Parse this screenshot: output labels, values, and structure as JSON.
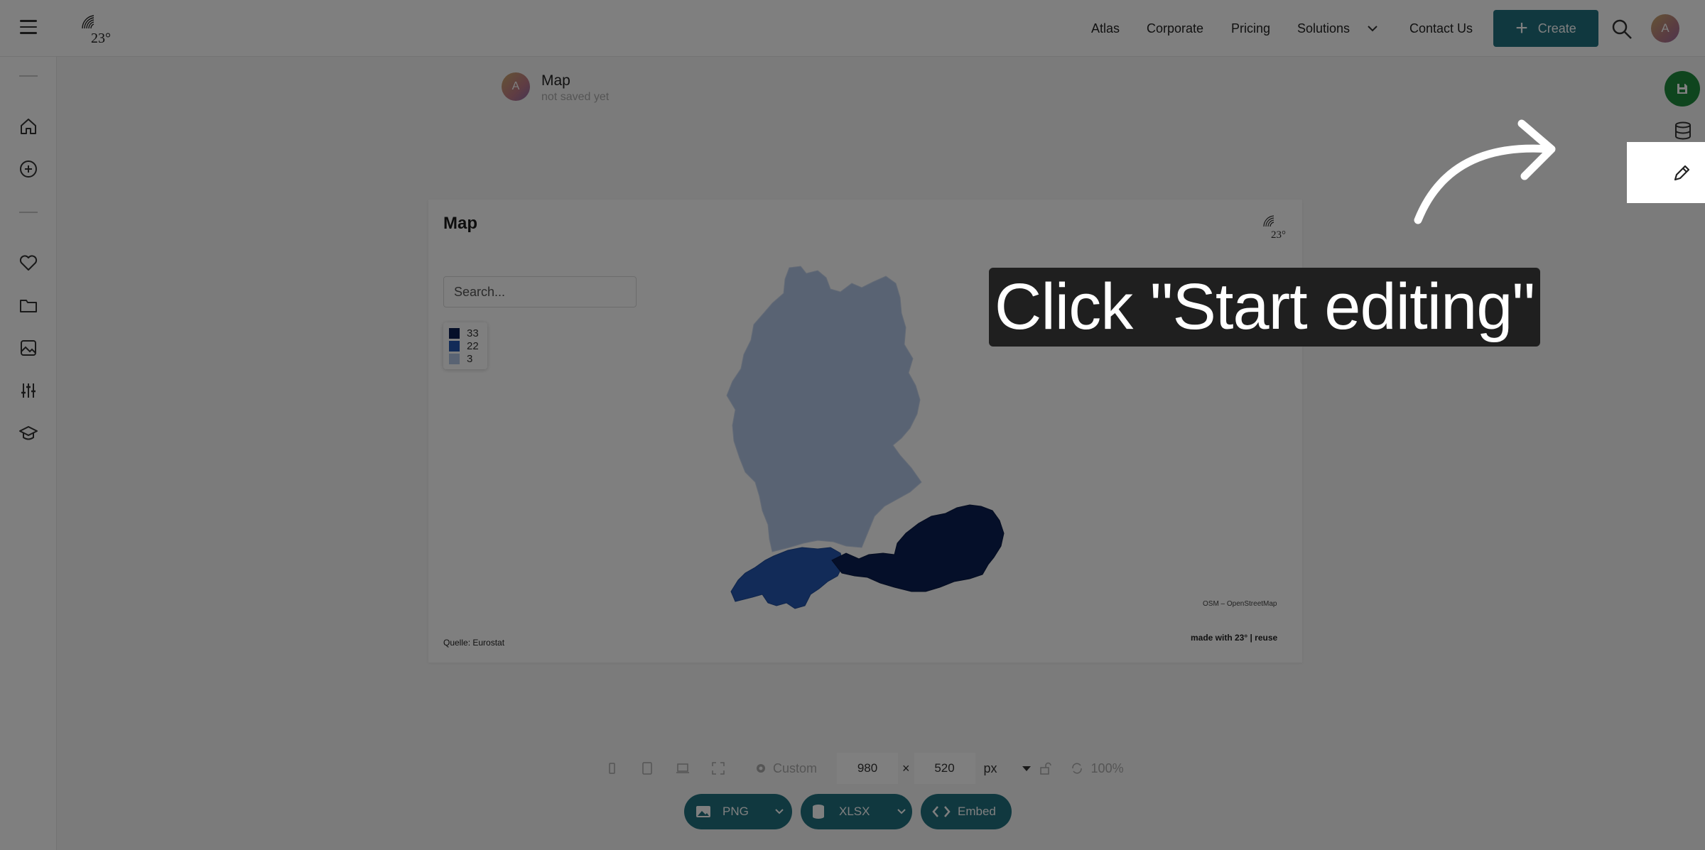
{
  "nav": {
    "items": [
      "Atlas",
      "Corporate",
      "Pricing",
      "Solutions",
      "Contact Us"
    ],
    "create_label": "Create",
    "avatar_initial": "A"
  },
  "logo_text": "23°",
  "doc": {
    "avatar_initial": "A",
    "title": "Map",
    "status": "not saved yet"
  },
  "map": {
    "title": "Map",
    "search_placeholder": "Search...",
    "legend": [
      {
        "label": "33",
        "color": "#0b1f52"
      },
      {
        "label": "22",
        "color": "#2556b0"
      },
      {
        "label": "3",
        "color": "#b3c7e6"
      }
    ],
    "attribution": "OSM – OpenStreetMap",
    "made_with": "made with 23° | reuse",
    "source": "Quelle: Eurostat"
  },
  "toolbar": {
    "preset": "Custom",
    "width": "980",
    "times": "×",
    "height": "520",
    "unit": "px",
    "zoom": "100%"
  },
  "export": {
    "png": "PNG",
    "xlsx": "XLSX",
    "embed": "Embed"
  },
  "tooltip": {
    "text": "Click \"Start editing\""
  },
  "colors": {
    "accent": "#20707e",
    "save": "#1f8a3c"
  }
}
